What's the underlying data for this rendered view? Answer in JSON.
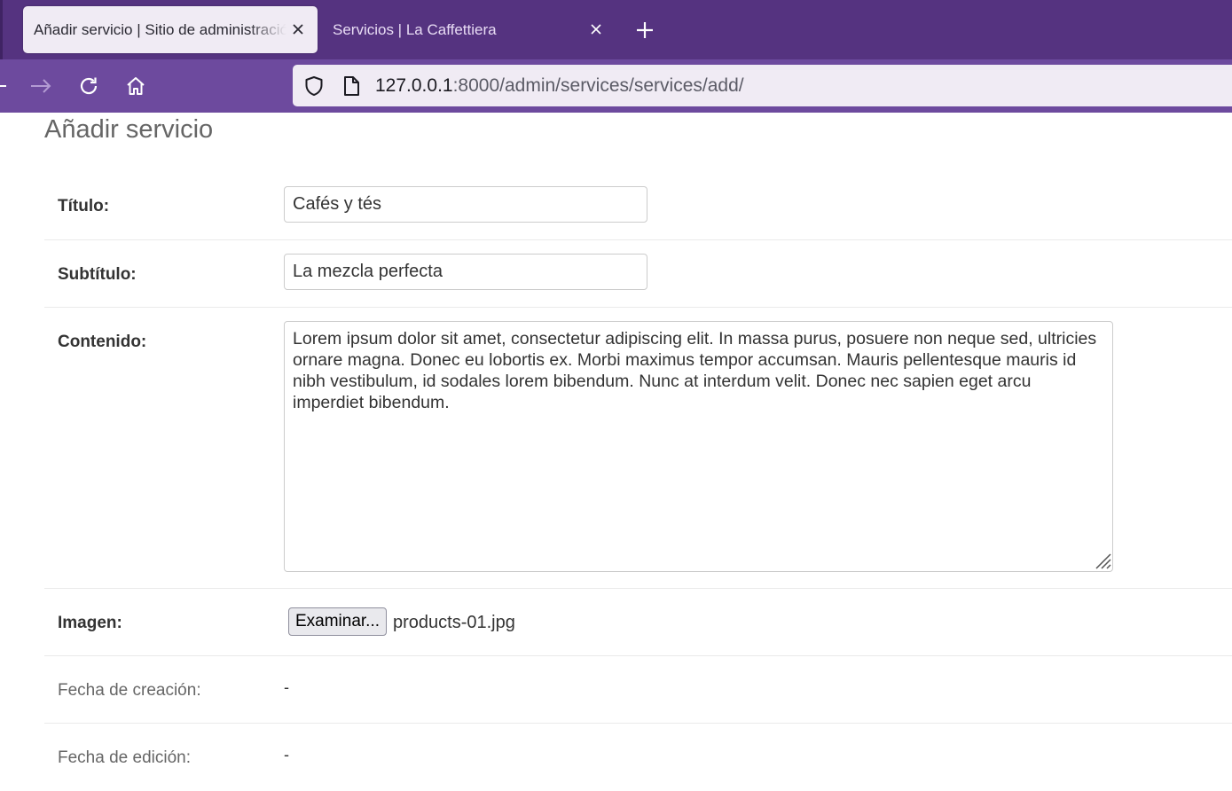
{
  "browser": {
    "tabs": [
      {
        "title": "Añadir servicio | Sitio de administración de Django",
        "active": true
      },
      {
        "title": "Servicios | La Caffettiera",
        "active": false
      }
    ],
    "url": {
      "host": "127.0.0.1",
      "path": ":8000/admin/services/services/add/"
    },
    "colors": {
      "tabbar": "#553380",
      "navbar": "#6d4a9e",
      "active_tab": "#f0ebf4"
    },
    "icons": [
      "back-icon",
      "forward-icon",
      "reload-icon",
      "home-icon",
      "shield-icon",
      "page-icon",
      "close-icon",
      "plus-icon"
    ]
  },
  "page": {
    "title": "Añadir servicio"
  },
  "form": {
    "titulo": {
      "label": "Título:",
      "value": "Cafés y tés"
    },
    "subtitulo": {
      "label": "Subtítulo:",
      "value": "La mezcla perfecta"
    },
    "contenido": {
      "label": "Contenido:",
      "value": "Lorem ipsum dolor sit amet, consectetur adipiscing elit. In massa purus, posuere non neque sed, ultricies ornare magna. Donec eu lobortis ex. Morbi maximus tempor accumsan. Mauris pellentesque mauris id nibh vestibulum, id sodales lorem bibendum. Nunc at interdum velit. Donec nec sapien eget arcu imperdiet bibendum."
    },
    "imagen": {
      "label": "Imagen:",
      "button": "Examinar...",
      "file": "products-01.jpg"
    },
    "creacion": {
      "label": "Fecha de creación:",
      "value": "-"
    },
    "edicion": {
      "label": "Fecha de edición:",
      "value": "-"
    }
  }
}
